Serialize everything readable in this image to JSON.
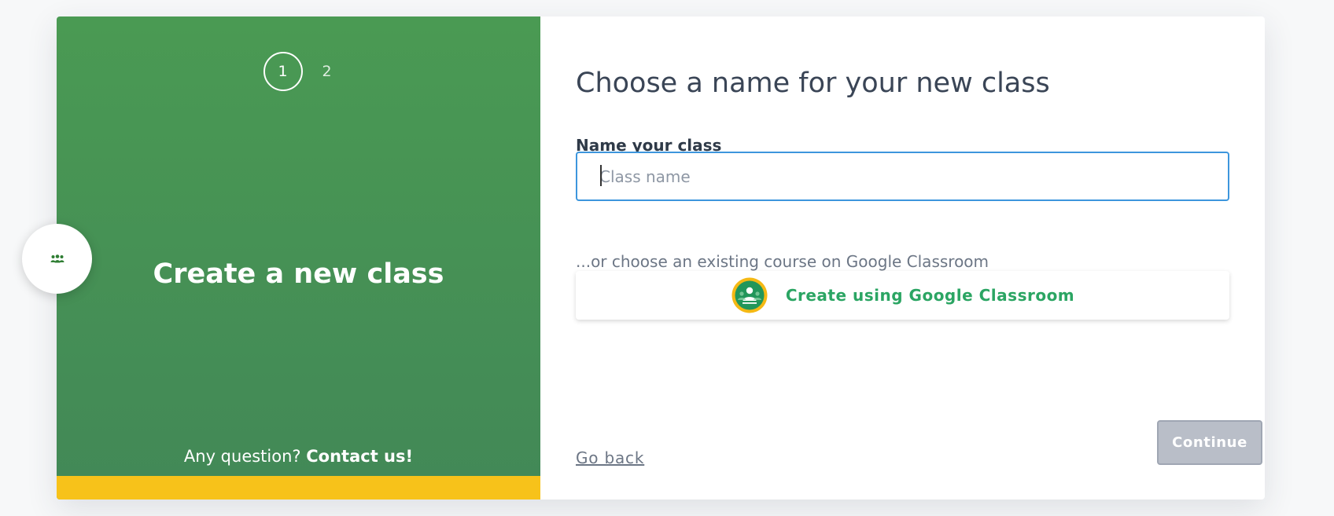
{
  "wizard": {
    "steps": [
      {
        "label": "1",
        "active": true
      },
      {
        "label": "2",
        "active": false
      }
    ]
  },
  "left_panel": {
    "title": "Create a new class",
    "contact_prefix": "Any question?",
    "contact_link": "Contact us!"
  },
  "side_bubble": {
    "icon": "users-icon"
  },
  "form": {
    "heading": "Choose a name for your new class",
    "name_label": "Name your class",
    "name_placeholder": "Class name",
    "name_value": "",
    "or_text": "...or choose an existing course on Google Classroom",
    "google_button_label": "Create using Google Classroom",
    "google_button_icon": "google-classroom-icon"
  },
  "footer": {
    "back_label": "Go back",
    "continue_label": "Continue"
  },
  "colors": {
    "panel_green": "#4a9a53",
    "accent_yellow": "#f7c21a",
    "input_focus_blue": "#3d96dd",
    "google_green": "#2ba563",
    "continue_disabled": "#b9bec8"
  }
}
